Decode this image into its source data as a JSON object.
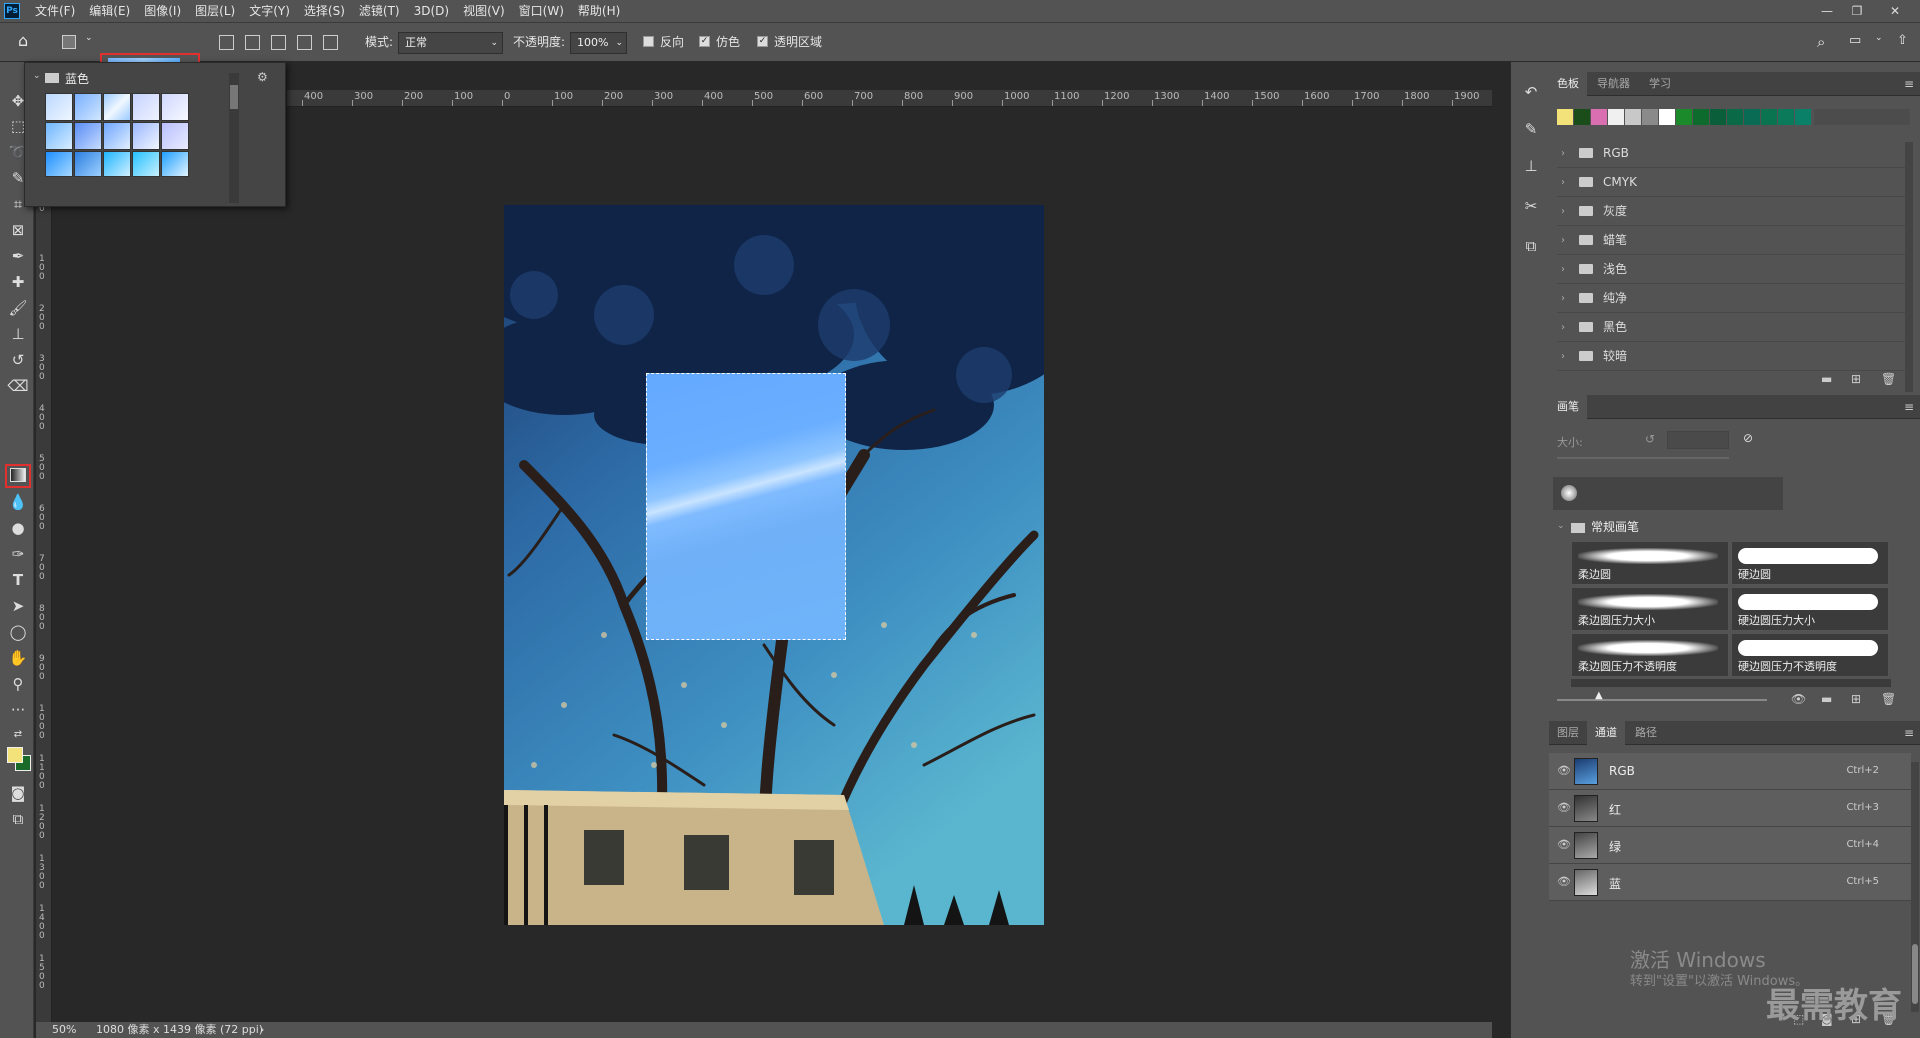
{
  "menubar": {
    "logo": "Ps",
    "items": [
      "文件(F)",
      "编辑(E)",
      "图像(I)",
      "图层(L)",
      "文字(Y)",
      "选择(S)",
      "滤镜(T)",
      "3D(D)",
      "视图(V)",
      "窗口(W)",
      "帮助(H)"
    ]
  },
  "options": {
    "mode_label": "模式:",
    "mode_value": "正常",
    "opacity_label": "不透明度:",
    "opacity_value": "100%",
    "reverse_label": "反向",
    "dither_label": "仿色",
    "transparency_label": "透明区域",
    "reverse_checked": false,
    "dither_checked": true,
    "transparency_checked": true
  },
  "gradient_picker": {
    "folder_name": "蓝色"
  },
  "ruler": {
    "top": [
      "400",
      "300",
      "200",
      "100",
      "0",
      "100",
      "200",
      "300",
      "400",
      "500",
      "600",
      "700",
      "800",
      "900",
      "1000",
      "1100",
      "1200",
      "1300",
      "1400",
      "1500",
      "1600",
      "1700",
      "1800",
      "1900"
    ],
    "left": [
      "0",
      "100",
      "200",
      "300",
      "400",
      "500",
      "600",
      "700",
      "800",
      "900",
      "1000",
      "1100",
      "1200",
      "1300",
      "1400",
      "1500"
    ]
  },
  "status": {
    "zoom": "50%",
    "doc_info": "1080 像素 x 1439 像素 (72 ppi)"
  },
  "swatches_panel": {
    "tabs": [
      "色板",
      "导航器",
      "学习"
    ],
    "colors": [
      "#f3e27a",
      "#1a4d1a",
      "#d96fb0",
      "#f0f0f0",
      "#c8c8c8",
      "#8a8a8a",
      "#ffffff",
      "#1a8a2a",
      "#0d6b2e",
      "#0b5e3a",
      "#0a6a48",
      "#0a6b55",
      "#0a7350",
      "#0a7a5a",
      "#0a8068"
    ],
    "folders": [
      "RGB",
      "CMYK",
      "灰度",
      "蜡笔",
      "浅色",
      "纯净",
      "黑色",
      "较暗"
    ]
  },
  "brush_panel": {
    "tab": "画笔",
    "size_label": "大小:",
    "group_name": "常规画笔",
    "brushes": [
      "柔边圆",
      "硬边圆",
      "柔边圆压力大小",
      "硬边圆压力大小",
      "柔边圆压力不透明度",
      "硬边圆压力不透明度"
    ]
  },
  "layers_panel": {
    "tabs": [
      "图层",
      "通道",
      "路径"
    ],
    "channels": [
      {
        "name": "RGB",
        "shortcut": "Ctrl+2"
      },
      {
        "name": "红",
        "shortcut": "Ctrl+3"
      },
      {
        "name": "绿",
        "shortcut": "Ctrl+4"
      },
      {
        "name": "蓝",
        "shortcut": "Ctrl+5"
      }
    ]
  },
  "watermark": {
    "line1": "激活 Windows",
    "line2": "转到\"设置\"以激活 Windows。",
    "brand": "最需教育"
  }
}
